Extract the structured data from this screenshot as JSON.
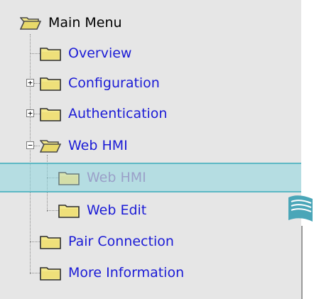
{
  "tree": {
    "root": {
      "label": "Main Menu",
      "icon": "folder-open-icon"
    },
    "items": [
      {
        "label": "Overview",
        "icon": "folder-icon",
        "expander": ""
      },
      {
        "label": "Configuration",
        "icon": "folder-icon",
        "expander": "+"
      },
      {
        "label": "Authentication",
        "icon": "folder-icon",
        "expander": "+"
      },
      {
        "label": "Web HMI",
        "icon": "folder-open-icon",
        "expander": "−",
        "children": [
          {
            "label": "Web HMI",
            "icon": "folder-icon",
            "selected": true
          },
          {
            "label": "Web Edit",
            "icon": "folder-icon"
          }
        ]
      },
      {
        "label": "Pair Connection",
        "icon": "folder-icon",
        "expander": ""
      },
      {
        "label": "More Information",
        "icon": "folder-icon",
        "expander": ""
      }
    ]
  },
  "colors": {
    "panel_bg": "#e6e6e6",
    "link": "#1b1bd6",
    "highlight": "#8cd6de",
    "folder_fill": "#f4e98a",
    "folder_stroke": "#4a4a4a"
  }
}
